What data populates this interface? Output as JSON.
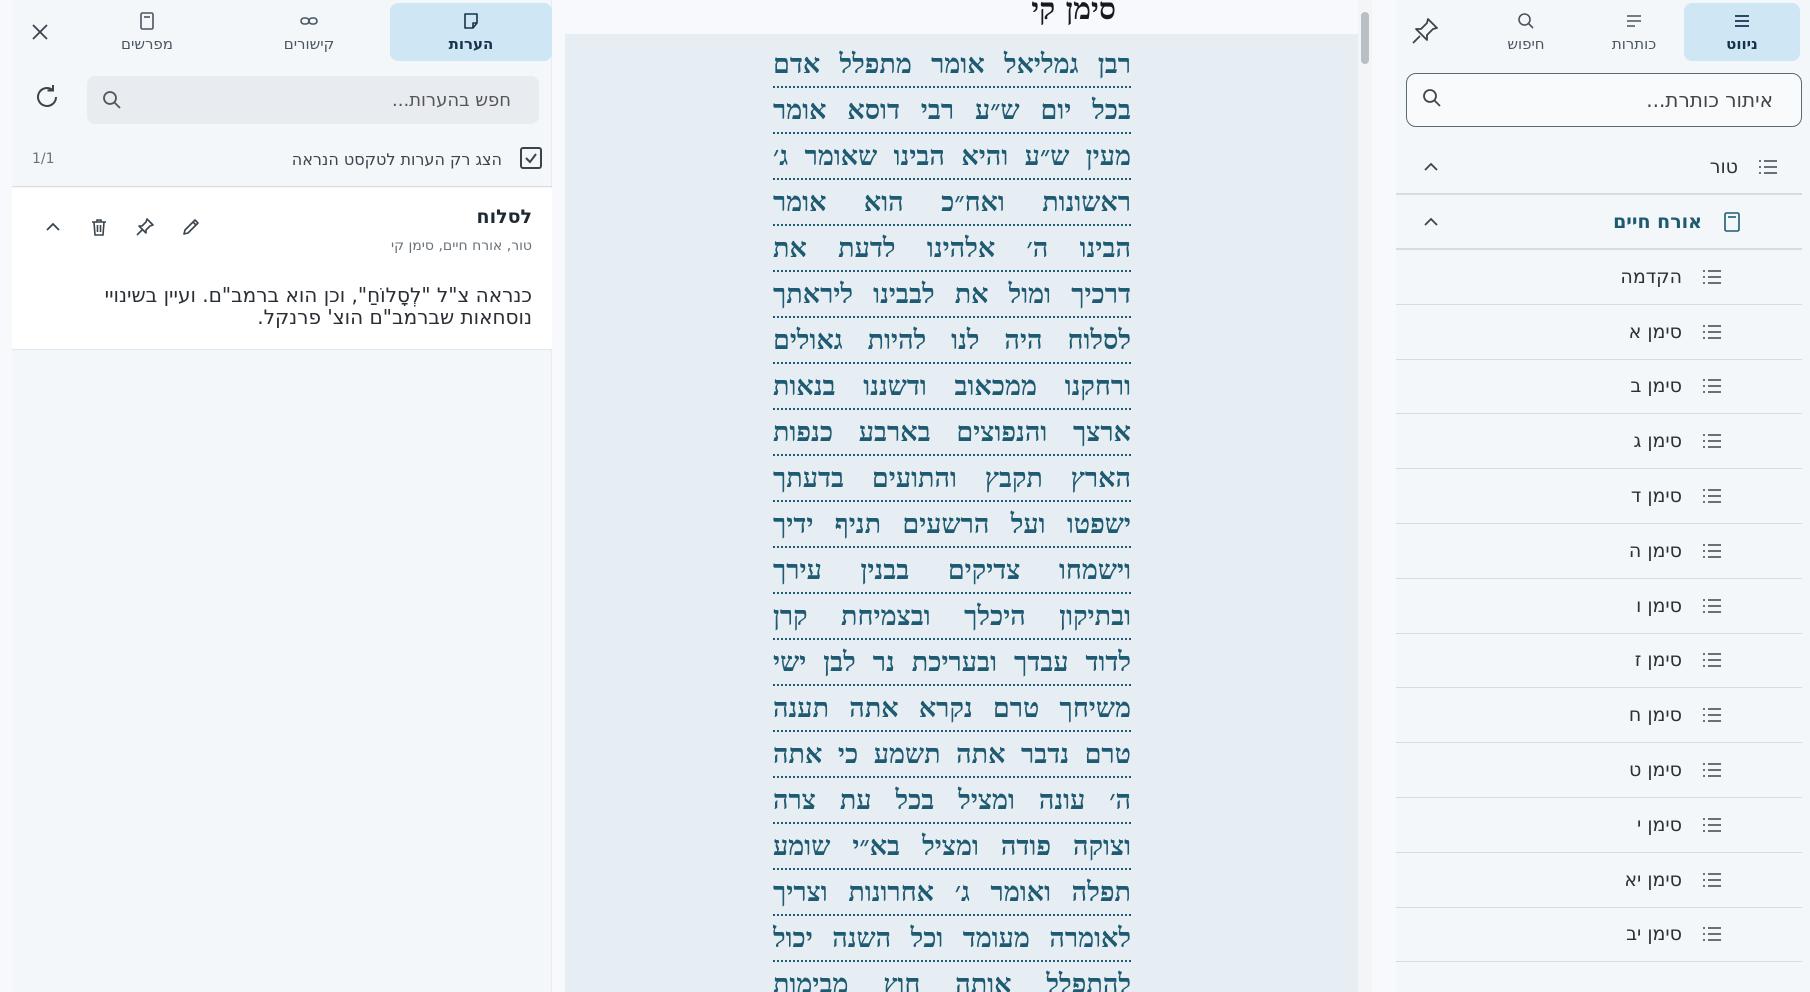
{
  "notes_panel": {
    "tabs": [
      {
        "label": "הערות",
        "icon": "note-icon",
        "active": true
      },
      {
        "label": "קישורים",
        "icon": "link-icon",
        "active": false
      },
      {
        "label": "מפרשים",
        "icon": "book-icon",
        "active": false
      }
    ],
    "search_placeholder": "חפש בהערות...",
    "filter_label": "הצג רק הערות לטקסט הנראה",
    "filter_checked": true,
    "count": "1/1",
    "note": {
      "title": "לסלוח",
      "subtitle": "טור, אורח חיים, סימן קי",
      "body": "כנראה צ\"ל \"לְסָלוֹחַ\", וכן הוא ברמב\"ם. ועיין בשינויי נוסחאות שברמב\"ם הוצ' פרנקל."
    }
  },
  "center": {
    "title": "סימן קי",
    "lines": [
      "רבן גמליאל אומר מתפלל אדם",
      "בכל יום ש״ע רבי דוסא אומר",
      "מעין ש״ע והיא הבינו שאומר ג׳",
      "ראשונות ואח״כ הוא אומר",
      "הבינו ה׳ אלהינו לדעת את",
      "דרכיך ומול את לבבינו ליראתך",
      "לסלוח היה לנו להיות גאולים",
      "ורחקנו ממכאוב ודשננו בנאות",
      "ארצך והנפוצים בארבע כנפות",
      "הארץ תקבץ והתועים בדעתך",
      "ישפטו ועל הרשעים תניף ידיך",
      "וישמחו צדיקים בבנין עירך",
      "ובתיקון היכלך ובצמיחת קרן",
      "לדוד עבדך ובעריכת נר לבן ישי",
      "משיחך טרם נקרא אתה תענה",
      "טרם נדבר אתה תשמע כי אתה",
      "ה׳ עונה ומציל בכל עת צרה",
      "וצוקה פודה ומציל בא״י שומע",
      "תפלה ואומר ג׳ אחרונות וצריך",
      "לאומרה מעומד וכל השנה יכול",
      "להתפלל אותה חוץ מבימות"
    ]
  },
  "nav_panel": {
    "tabs": [
      {
        "label": "ניווט",
        "icon": "menu-icon",
        "active": true
      },
      {
        "label": "כותרות",
        "icon": "headings-icon",
        "active": false
      },
      {
        "label": "חיפוש",
        "icon": "search-icon",
        "active": false
      }
    ],
    "search_placeholder": "איתור כותרת...",
    "tree": {
      "root": "טור",
      "section": "אורח חיים",
      "children": [
        "הקדמה",
        "סימן א",
        "סימן ב",
        "סימן ג",
        "סימן ד",
        "סימן ה",
        "סימן ו",
        "סימן ז",
        "סימן ח",
        "סימן ט",
        "סימן י",
        "סימן יא",
        "סימן יב"
      ]
    }
  },
  "colors": {
    "accent_tab": "#cfe6f5",
    "text_link": "#1e5a72"
  }
}
